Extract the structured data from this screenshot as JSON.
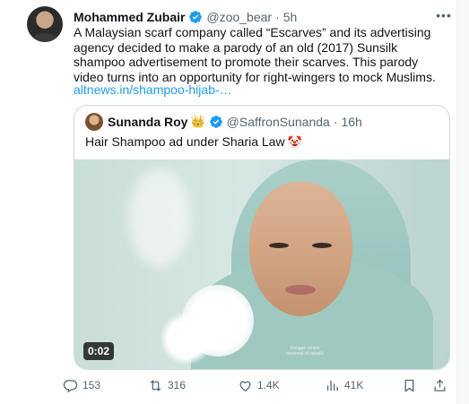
{
  "tweet": {
    "author_name": "Mohammed Zubair",
    "handle": "@zoo_bear",
    "separator": "·",
    "time": "5h",
    "more_icon": "more-icon",
    "text": "A Malaysian scarf company called “Escarves” and its advertising agency decided to make a parody of an old (2017) Sunsilk shampoo advertisement to promote their scarves. This parody video turns into an opportunity for right-wingers to mock Muslims.",
    "link": "altnews.in/shampoo-hijab-…"
  },
  "quote": {
    "author_name": "Sunanda Roy",
    "crown_emoji": "👑",
    "handle": "@SaffronSunanda",
    "separator": "·",
    "time": "16h",
    "text": "Hair Shampoo ad under Sharia Law",
    "emoji": "🤡",
    "video_duration": "0:02",
    "video_caption": "Dengan rahsia tersemat di sebalik"
  },
  "actions": {
    "replies": "153",
    "reposts": "316",
    "likes": "1.4K",
    "views": "41K"
  },
  "colors": {
    "accent": "#1d9bf0",
    "secondary_text": "#536471",
    "border": "#cfd9de"
  }
}
